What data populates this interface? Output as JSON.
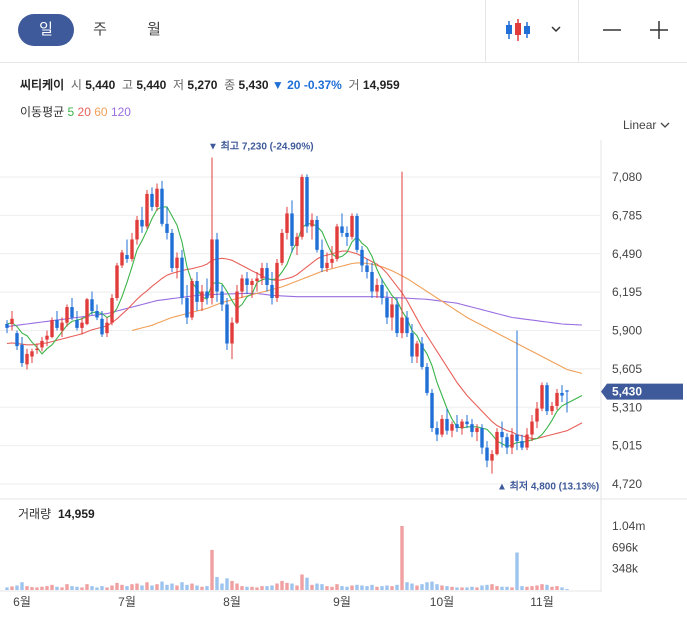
{
  "tabs": {
    "day": "일",
    "week": "주",
    "month": "월"
  },
  "controls": {
    "chart_type_icon": "candlestick-icon",
    "dropdown_icon": "chevron-down-icon",
    "zoom_out": "—",
    "zoom_in": "+"
  },
  "stock": {
    "name": "씨티케이",
    "open_label": "시",
    "open": "5,440",
    "high_label": "고",
    "high": "5,440",
    "low_label": "저",
    "low": "5,270",
    "close_label": "종",
    "close": "5,430",
    "change_arrow": "▼",
    "change": "20",
    "change_pct": "-0.37%",
    "volume_label": "거",
    "volume": "14,959"
  },
  "moving_average": {
    "label": "이동평균",
    "periods": [
      {
        "value": "5",
        "color": "#3cb44b"
      },
      {
        "value": "20",
        "color": "#e8615b"
      },
      {
        "value": "60",
        "color": "#f0a058"
      },
      {
        "value": "120",
        "color": "#9a6ee0"
      }
    ]
  },
  "scale": "Linear",
  "volume_panel": {
    "label": "거래량",
    "value": "14,959"
  },
  "chart_data": {
    "type": "candlestick",
    "colors": {
      "up": "#e03c3c",
      "down": "#1f6fd6",
      "current": "#3f5a9a"
    },
    "y_ticks": [
      "7,080",
      "6,785",
      "6,490",
      "6,195",
      "5,900",
      "5,605",
      "5,310",
      "5,015",
      "4,720"
    ],
    "ylim": [
      4720,
      7080
    ],
    "volume_ticks": [
      "1.04m",
      "696k",
      "348k"
    ],
    "x_labels": [
      {
        "label": "6월",
        "index": 3
      },
      {
        "label": "7월",
        "index": 24
      },
      {
        "label": "8월",
        "index": 45
      },
      {
        "label": "9월",
        "index": 67
      },
      {
        "label": "10월",
        "index": 87
      },
      {
        "label": "11월",
        "index": 107
      }
    ],
    "current_price": "5,430",
    "high_annotation": {
      "marker": "▼",
      "label": "최고",
      "value": "7,230",
      "pct": "(-24.90%)",
      "index": 41,
      "price": 7230
    },
    "low_annotation": {
      "marker": "▲",
      "label": "최저",
      "value": "4,800",
      "pct": "(13.13%)",
      "index": 98,
      "price": 4800
    },
    "candles": [
      [
        5950,
        5980,
        5880,
        5920,
        40
      ],
      [
        5950,
        6050,
        5900,
        5990,
        55
      ],
      [
        5880,
        5900,
        5750,
        5780,
        70
      ],
      [
        5790,
        5850,
        5620,
        5650,
        120
      ],
      [
        5640,
        5760,
        5600,
        5720,
        60
      ],
      [
        5700,
        5760,
        5650,
        5740,
        45
      ],
      [
        5750,
        5800,
        5720,
        5760,
        40
      ],
      [
        5770,
        5850,
        5740,
        5820,
        50
      ],
      [
        5830,
        5900,
        5780,
        5860,
        60
      ],
      [
        5850,
        6000,
        5840,
        5980,
        80
      ],
      [
        5980,
        6050,
        5900,
        5920,
        50
      ],
      [
        5900,
        6000,
        5850,
        5960,
        40
      ],
      [
        5960,
        6100,
        5930,
        6080,
        90
      ],
      [
        6080,
        6150,
        5980,
        6000,
        60
      ],
      [
        5980,
        6050,
        5900,
        5920,
        50
      ],
      [
        5920,
        6000,
        5870,
        5960,
        40
      ],
      [
        5950,
        6150,
        5940,
        6140,
        90
      ],
      [
        6140,
        6200,
        6020,
        6050,
        60
      ],
      [
        6050,
        6100,
        5980,
        6000,
        40
      ],
      [
        5990,
        6050,
        5850,
        5870,
        60
      ],
      [
        5880,
        6000,
        5850,
        5960,
        40
      ],
      [
        5960,
        6180,
        5940,
        6150,
        70
      ],
      [
        6150,
        6420,
        6130,
        6400,
        110
      ],
      [
        6400,
        6520,
        6380,
        6500,
        80
      ],
      [
        6480,
        6600,
        6420,
        6450,
        60
      ],
      [
        6450,
        6650,
        6430,
        6600,
        90
      ],
      [
        6600,
        6780,
        6560,
        6750,
        100
      ],
      [
        6750,
        6850,
        6650,
        6700,
        70
      ],
      [
        6700,
        6980,
        6680,
        6950,
        120
      ],
      [
        6950,
        7000,
        6820,
        6850,
        70
      ],
      [
        6850,
        7030,
        6820,
        6990,
        90
      ],
      [
        6990,
        7050,
        6700,
        6720,
        130
      ],
      [
        6720,
        6850,
        6600,
        6650,
        80
      ],
      [
        6650,
        6680,
        6350,
        6380,
        100
      ],
      [
        6380,
        6500,
        6300,
        6460,
        70
      ],
      [
        6460,
        6520,
        6100,
        6150,
        120
      ],
      [
        6150,
        6250,
        5950,
        6000,
        80
      ],
      [
        6000,
        6300,
        5980,
        6280,
        100
      ],
      [
        6280,
        6350,
        6050,
        6120,
        70
      ],
      [
        6120,
        6250,
        6050,
        6200,
        50
      ],
      [
        6200,
        6300,
        6100,
        6150,
        60
      ],
      [
        6150,
        7230,
        6100,
        6600,
        620
      ],
      [
        6600,
        6650,
        6120,
        6200,
        200
      ],
      [
        6200,
        6250,
        6050,
        6100,
        100
      ],
      [
        6100,
        6150,
        5750,
        5800,
        180
      ],
      [
        5800,
        6000,
        5680,
        5960,
        140
      ],
      [
        5960,
        6250,
        5950,
        6200,
        100
      ],
      [
        6200,
        6330,
        6150,
        6300,
        60
      ],
      [
        6300,
        6350,
        6180,
        6250,
        50
      ],
      [
        6250,
        6300,
        6150,
        6280,
        50
      ],
      [
        6280,
        6350,
        6200,
        6300,
        40
      ],
      [
        6300,
        6420,
        6250,
        6380,
        60
      ],
      [
        6380,
        6420,
        6200,
        6250,
        60
      ],
      [
        6250,
        6350,
        6100,
        6150,
        70
      ],
      [
        6150,
        6450,
        6120,
        6420,
        100
      ],
      [
        6420,
        6680,
        6400,
        6650,
        140
      ],
      [
        6650,
        6850,
        6600,
        6800,
        110
      ],
      [
        6800,
        6900,
        6500,
        6550,
        100
      ],
      [
        6550,
        6650,
        6480,
        6620,
        70
      ],
      [
        6620,
        7100,
        6600,
        7080,
        240
      ],
      [
        7080,
        7100,
        6650,
        6700,
        190
      ],
      [
        6700,
        6800,
        6600,
        6750,
        80
      ],
      [
        6750,
        6780,
        6500,
        6520,
        100
      ],
      [
        6520,
        6600,
        6350,
        6380,
        90
      ],
      [
        6380,
        6500,
        6350,
        6420,
        60
      ],
      [
        6420,
        6550,
        6380,
        6450,
        50
      ],
      [
        6450,
        6720,
        6430,
        6700,
        90
      ],
      [
        6700,
        6800,
        6620,
        6650,
        60
      ],
      [
        6650,
        6700,
        6550,
        6620,
        50
      ],
      [
        6620,
        6800,
        6600,
        6780,
        70
      ],
      [
        6780,
        6800,
        6500,
        6520,
        80
      ],
      [
        6520,
        6550,
        6350,
        6400,
        70
      ],
      [
        6400,
        6450,
        6300,
        6350,
        60
      ],
      [
        6350,
        6420,
        6150,
        6200,
        80
      ],
      [
        6200,
        6300,
        6150,
        6250,
        50
      ],
      [
        6250,
        6300,
        6100,
        6150,
        60
      ],
      [
        6150,
        6200,
        5950,
        6000,
        70
      ],
      [
        6000,
        6150,
        5900,
        6100,
        60
      ],
      [
        6100,
        6150,
        5850,
        5880,
        80
      ],
      [
        5880,
        7120,
        5840,
        6000,
        990
      ],
      [
        6000,
        6050,
        5850,
        5880,
        120
      ],
      [
        5880,
        5950,
        5650,
        5700,
        100
      ],
      [
        5700,
        5820,
        5650,
        5800,
        70
      ],
      [
        5800,
        5850,
        5600,
        5620,
        90
      ],
      [
        5620,
        5650,
        5400,
        5420,
        120
      ],
      [
        5420,
        5450,
        5120,
        5150,
        130
      ],
      [
        5150,
        5200,
        5050,
        5100,
        90
      ],
      [
        5100,
        5250,
        5080,
        5220,
        70
      ],
      [
        5220,
        5300,
        5100,
        5130,
        60
      ],
      [
        5130,
        5200,
        5080,
        5180,
        50
      ],
      [
        5180,
        5250,
        5120,
        5150,
        40
      ],
      [
        5150,
        5220,
        5100,
        5200,
        40
      ],
      [
        5200,
        5250,
        5150,
        5180,
        40
      ],
      [
        5180,
        5220,
        5080,
        5120,
        50
      ],
      [
        5120,
        5180,
        5050,
        5150,
        40
      ],
      [
        5150,
        5180,
        4950,
        5000,
        70
      ],
      [
        5000,
        5050,
        4850,
        4900,
        80
      ],
      [
        4900,
        4980,
        4800,
        4950,
        90
      ],
      [
        4950,
        5150,
        4940,
        5120,
        60
      ],
      [
        5120,
        5200,
        5000,
        5080,
        50
      ],
      [
        5080,
        5110,
        4950,
        5000,
        50
      ],
      [
        5000,
        5150,
        4950,
        5100,
        40
      ],
      [
        5100,
        5900,
        4980,
        5050,
        580
      ],
      [
        5050,
        5100,
        4980,
        5000,
        60
      ],
      [
        5000,
        5150,
        4980,
        5100,
        50
      ],
      [
        5100,
        5250,
        5050,
        5200,
        60
      ],
      [
        5200,
        5350,
        5150,
        5300,
        70
      ],
      [
        5300,
        5500,
        5280,
        5480,
        90
      ],
      [
        5480,
        5500,
        5250,
        5280,
        80
      ],
      [
        5280,
        5350,
        5250,
        5320,
        50
      ],
      [
        5320,
        5450,
        5290,
        5420,
        60
      ],
      [
        5420,
        5480,
        5350,
        5400,
        40
      ],
      [
        5440,
        5440,
        5270,
        5430,
        15
      ]
    ],
    "ma5": [
      5950,
      5960,
      5930,
      5880,
      5860,
      5810,
      5770,
      5720,
      5760,
      5790,
      5840,
      5890,
      5940,
      5970,
      5980,
      5990,
      6010,
      6040,
      6040,
      6030,
      6000,
      6020,
      6070,
      6160,
      6270,
      6390,
      6520,
      6590,
      6670,
      6760,
      6830,
      6850,
      6850,
      6780,
      6710,
      6580,
      6390,
      6270,
      6220,
      6160,
      6140,
      6260,
      6270,
      6260,
      6200,
      6130,
      6070,
      6100,
      6160,
      6180,
      6270,
      6290,
      6300,
      6290,
      6300,
      6350,
      6410,
      6510,
      6580,
      6690,
      6720,
      6720,
      6700,
      6660,
      6570,
      6490,
      6460,
      6470,
      6500,
      6580,
      6620,
      6570,
      6540,
      6470,
      6370,
      6290,
      6230,
      6170,
      6130,
      6050,
      5990,
      5900,
      5860,
      5780,
      5720,
      5630,
      5500,
      5400,
      5300,
      5220,
      5160,
      5150,
      5160,
      5160,
      5160,
      5150,
      5140,
      5100,
      5050,
      5030,
      5010,
      5020,
      5040,
      5040,
      5050,
      5060,
      5070,
      5100,
      5150,
      5210,
      5280,
      5320,
      5340,
      5360,
      5380,
      5400
    ],
    "ma20": [
      5800,
      5805,
      5800,
      5795,
      5790,
      5790,
      5795,
      5800,
      5805,
      5815,
      5825,
      5835,
      5845,
      5855,
      5865,
      5875,
      5890,
      5905,
      5915,
      5925,
      5935,
      5960,
      5990,
      6025,
      6060,
      6100,
      6140,
      6175,
      6205,
      6240,
      6270,
      6300,
      6325,
      6340,
      6350,
      6360,
      6370,
      6375,
      6385,
      6395,
      6410,
      6440,
      6450,
      6455,
      6450,
      6440,
      6420,
      6400,
      6380,
      6360,
      6340,
      6320,
      6300,
      6290,
      6285,
      6290,
      6300,
      6310,
      6330,
      6360,
      6390,
      6420,
      6450,
      6470,
      6480,
      6490,
      6500,
      6510,
      6510,
      6500,
      6490,
      6470,
      6450,
      6430,
      6410,
      6380,
      6340,
      6290,
      6240,
      6190,
      6130,
      6060,
      5990,
      5920,
      5860,
      5800,
      5740,
      5680,
      5620,
      5560,
      5500,
      5450,
      5400,
      5360,
      5320,
      5280,
      5240,
      5200,
      5170,
      5150,
      5130,
      5120,
      5100,
      5090,
      5080,
      5070,
      5070,
      5080,
      5090,
      5100,
      5110,
      5120,
      5130,
      5150,
      5170,
      5190
    ],
    "ma60": [
      null,
      null,
      null,
      null,
      null,
      null,
      null,
      null,
      null,
      null,
      null,
      null,
      null,
      null,
      null,
      null,
      null,
      null,
      null,
      null,
      null,
      null,
      null,
      null,
      null,
      5900,
      5910,
      5920,
      5930,
      5940,
      5955,
      5970,
      5985,
      6000,
      6010,
      6020,
      6030,
      6040,
      6050,
      6060,
      6070,
      6085,
      6100,
      6115,
      6125,
      6135,
      6145,
      6155,
      6165,
      6175,
      6185,
      6195,
      6205,
      6215,
      6225,
      6235,
      6250,
      6265,
      6280,
      6295,
      6310,
      6325,
      6340,
      6355,
      6365,
      6375,
      6385,
      6395,
      6405,
      6415,
      6420,
      6420,
      6415,
      6410,
      6400,
      6390,
      6375,
      6360,
      6340,
      6320,
      6300,
      6275,
      6250,
      6225,
      6200,
      6175,
      6150,
      6125,
      6100,
      6075,
      6050,
      6025,
      6000,
      5980,
      5960,
      5940,
      5920,
      5900,
      5880,
      5860,
      5840,
      5820,
      5800,
      5780,
      5760,
      5740,
      5720,
      5700,
      5680,
      5660,
      5640,
      5620,
      5600,
      5590,
      5580,
      5570
    ],
    "ma120": [
      5930,
      5935,
      5940,
      5945,
      5950,
      5955,
      5960,
      5965,
      5970,
      5975,
      5980,
      5985,
      5990,
      5995,
      6000,
      6005,
      6010,
      6015,
      6020,
      6025,
      6030,
      6040,
      6050,
      6060,
      6070,
      6080,
      6090,
      6100,
      6110,
      6120,
      6130,
      6135,
      6140,
      6145,
      6150,
      6155,
      6160,
      6165,
      6170,
      6172,
      6174,
      6176,
      6178,
      6180,
      6181,
      6182,
      6183,
      6184,
      6185,
      6185,
      6185,
      6180,
      6175,
      6170,
      6168,
      6166,
      6164,
      6162,
      6160,
      6160,
      6160,
      6160,
      6160,
      6160,
      6160,
      6160,
      6160,
      6160,
      6160,
      6160,
      6160,
      6160,
      6160,
      6160,
      6160,
      6158,
      6156,
      6154,
      6152,
      6150,
      6148,
      6146,
      6144,
      6142,
      6140,
      6135,
      6130,
      6125,
      6120,
      6115,
      6110,
      6100,
      6090,
      6080,
      6070,
      6060,
      6050,
      6040,
      6030,
      6020,
      6010,
      6000,
      5995,
      5990,
      5985,
      5980,
      5975,
      5970,
      5965,
      5960,
      5955,
      5950,
      5948,
      5946,
      5944,
      5942
    ]
  }
}
